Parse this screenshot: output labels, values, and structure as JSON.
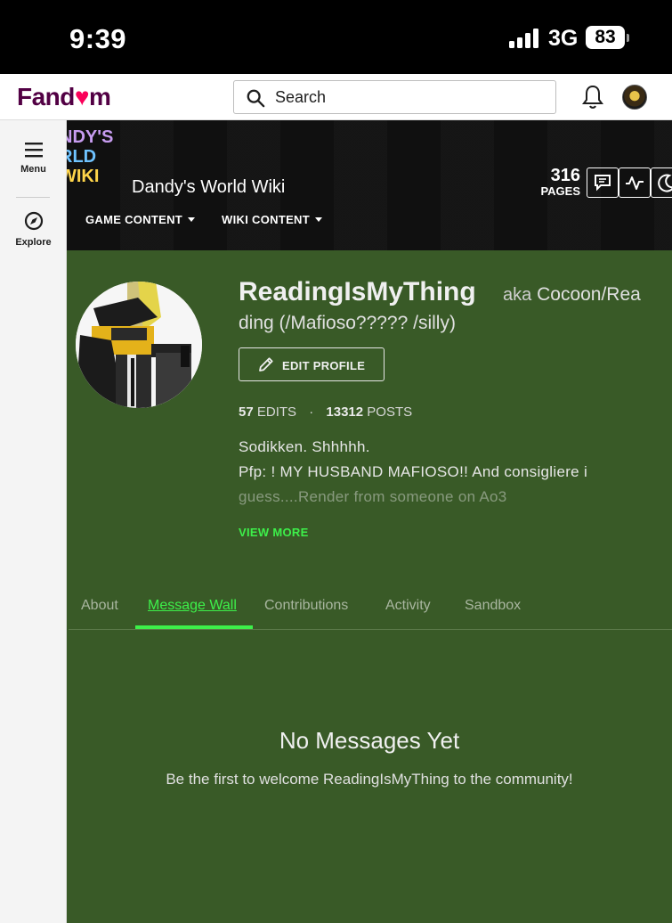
{
  "status_bar": {
    "time": "9:39",
    "network": "3G",
    "battery": "83"
  },
  "fandom": {
    "logo_left": "Fand",
    "logo_heart": "♥",
    "logo_right": "m",
    "search_placeholder": "Search"
  },
  "left_rail": {
    "menu_label": "Menu",
    "explore_label": "Explore"
  },
  "community": {
    "logo_lines": [
      "NDY'S",
      "RLD",
      "WIKI"
    ],
    "wiki_name": "Dandy's World Wiki",
    "nav": [
      {
        "label": "GAME CONTENT"
      },
      {
        "label": "WIKI CONTENT"
      }
    ],
    "pages_count": "316",
    "pages_label": "PAGES"
  },
  "profile": {
    "username": "ReadingIsMyThing",
    "aka_prefix": "aka",
    "aka_line1": "Cocoon/Rea",
    "aka_line2": "ding (/Mafioso????? /silly)",
    "edit_label": "EDIT PROFILE",
    "edits_count": "57",
    "edits_label": "EDITS",
    "posts_count": "13312",
    "posts_label": "POSTS",
    "bio_line1": "Sodikken. Shhhhh.",
    "bio_line2": "Pfp: ! MY HUSBAND MAFIOSO!! And consigliere i",
    "bio_line3": "guess....Render from someone on Ao3",
    "view_more": "VIEW MORE"
  },
  "tabs": [
    {
      "label": "About"
    },
    {
      "label": "Message Wall"
    },
    {
      "label": "Contributions"
    },
    {
      "label": "Activity"
    },
    {
      "label": "Sandbox"
    }
  ],
  "empty_state": {
    "title": "No Messages Yet",
    "subtitle": "Be the first to welcome ReadingIsMyThing to the community!"
  },
  "colors": {
    "page_bg": "#395a27",
    "accent": "#3df04a",
    "fandom_brand": "#520044",
    "fandom_heart": "#fa005a"
  },
  "icons": {
    "search": "search-icon",
    "bell": "bell-icon",
    "menu": "hamburger-icon",
    "explore": "compass-icon",
    "edit": "pencil-icon",
    "discussions": "discussions-icon",
    "activity": "activity-icon",
    "theme": "moon-icon"
  }
}
